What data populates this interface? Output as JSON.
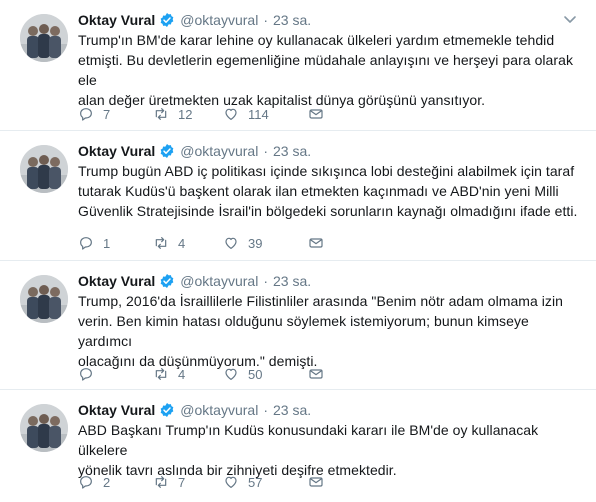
{
  "colors": {
    "text": "#14171a",
    "secondary": "#657786",
    "verified": "#1da1f2",
    "divider": "#e6ecf0"
  },
  "icons": {
    "avatar": "profile-photo-three-men",
    "verified": "verified-badge-icon",
    "caret": "chevron-down-icon",
    "reply": "reply-icon",
    "retweet": "retweet-icon",
    "like": "heart-icon",
    "dm": "envelope-icon"
  },
  "tweets": [
    {
      "name": "Oktay Vural",
      "handle": "@oktayvural",
      "separator": "·",
      "time": "23 sa.",
      "lines": [
        "Trump'ın BM'de karar lehine oy kullanacak ülkeleri yardım etmemekle tehdid",
        "etmişti. Bu devletlerin egemenliğine müdahale anlayışını ve herşeyi para olarak ele",
        "alan değer üretmekten uzak kapitalist dünya görüşünü yansıtıyor."
      ],
      "replies": "7",
      "retweets": "12",
      "likes": "114"
    },
    {
      "name": "Oktay Vural",
      "handle": "@oktayvural",
      "separator": "·",
      "time": "23 sa.",
      "lines": [
        "Trump bugün ABD iç politikası içinde sıkışınca lobi desteğini alabilmek için taraf",
        "tutarak Kudüs'ü başkent olarak ilan etmekten kaçınmadı ve ABD'nin yeni Milli",
        "Güvenlik Stratejisinde İsrail'in bölgedeki sorunların kaynağı olmadığını ifade etti."
      ],
      "replies": "1",
      "retweets": "4",
      "likes": "39"
    },
    {
      "name": "Oktay Vural",
      "handle": "@oktayvural",
      "separator": "·",
      "time": "23 sa.",
      "lines": [
        "Trump, 2016'da İsraillilerle Filistinliler arasında \"Benim nötr adam olmama izin",
        "verin. Ben kimin hatası olduğunu söylemek istemiyorum; bunun kimseye yardımcı",
        "olacağını da düşünmüyorum.\" demişti."
      ],
      "replies": "",
      "retweets": "4",
      "likes": "50"
    },
    {
      "name": "Oktay Vural",
      "handle": "@oktayvural",
      "separator": "·",
      "time": "23 sa.",
      "lines": [
        "ABD Başkanı Trump'ın Kudüs konusundaki kararı ile BM'de oy kullanacak ülkelere",
        "yönelik tavrı aslında bir zihniyeti deşifre etmektedir."
      ],
      "replies": "2",
      "retweets": "7",
      "likes": "57"
    }
  ]
}
